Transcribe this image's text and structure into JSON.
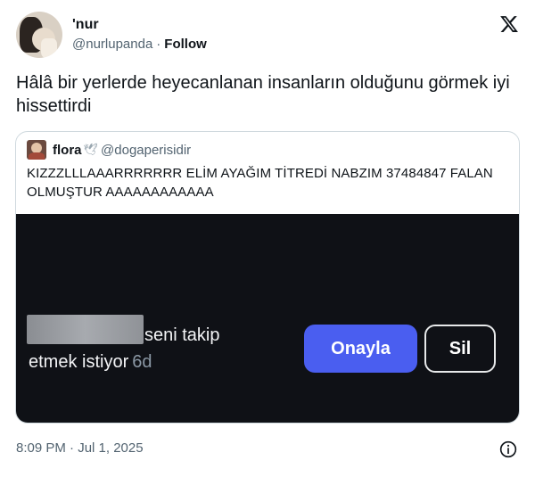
{
  "author": {
    "display_name": "'nur",
    "handle": "@nurlupanda",
    "separator": "·",
    "follow_label": "Follow"
  },
  "icons": {
    "logo": "x-logo-icon",
    "info": "info-icon"
  },
  "tweet": {
    "text": "Hâlâ bir yerlerde heyecanlanan insanların olduğunu görmek iyi hissettirdi",
    "timestamp": "8:09 PM · Jul 1, 2025"
  },
  "quote": {
    "display_name": "flora",
    "emoji": "🕊",
    "handle": "@dogaperisidir",
    "text": "KIZZZLLLAAARRRRRRR ELİM AYAĞIM TİTREDİ NABZIM 37484847 FALAN OLMUŞTUR AAAAAAAAAAAA",
    "media": {
      "notification_line1": "seni takip",
      "notification_line2": "etmek istiyor",
      "time_ago": "6d",
      "confirm_label": "Onayla",
      "delete_label": "Sil",
      "colors": {
        "background": "#0f1116",
        "confirm": "#4a5ef0"
      }
    }
  }
}
